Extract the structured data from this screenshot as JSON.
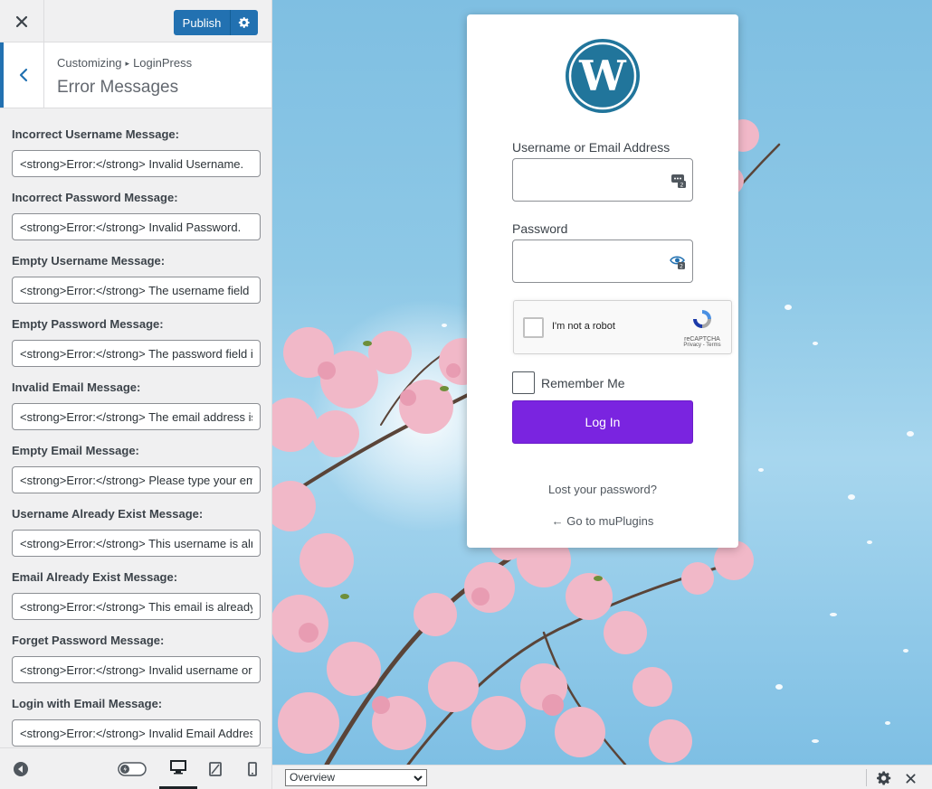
{
  "topbar": {
    "publish_label": "Publish"
  },
  "section": {
    "breadcrumb_parent": "Customizing",
    "breadcrumb_child": "LoginPress",
    "title": "Error Messages"
  },
  "controls": [
    {
      "label": "Incorrect Username Message:",
      "value": "<strong>Error:</strong> Invalid Username."
    },
    {
      "label": "Incorrect Password Message:",
      "value": "<strong>Error:</strong> Invalid Password."
    },
    {
      "label": "Empty Username Message:",
      "value": "<strong>Error:</strong> The username field is empty."
    },
    {
      "label": "Empty Password Message:",
      "value": "<strong>Error:</strong> The password field is empty."
    },
    {
      "label": "Invalid Email Message:",
      "value": "<strong>Error:</strong> The email address isn't correct.."
    },
    {
      "label": "Empty Email Message:",
      "value": "<strong>Error:</strong> Please type your email address."
    },
    {
      "label": "Username Already Exist Message:",
      "value": "<strong>Error:</strong> This username is already registered."
    },
    {
      "label": "Email Already Exist Message:",
      "value": "<strong>Error:</strong> This email is already registered."
    },
    {
      "label": "Forget Password Message:",
      "value": "<strong>Error:</strong> Invalid username or email."
    },
    {
      "label": "Login with Email Message:",
      "value": "<strong>Error:</strong> Invalid Email Address"
    }
  ],
  "login": {
    "username_label": "Username or Email Address",
    "password_label": "Password",
    "recaptcha_text": "I'm not a robot",
    "recaptcha_brand": "reCAPTCHA",
    "recaptcha_links": "Privacy - Terms",
    "remember_label": "Remember Me",
    "login_button": "Log In",
    "lost_password": "Lost your password?",
    "back_link": "← Go to muPlugins",
    "button_color": "#7a24e0"
  },
  "preview_bar": {
    "select_value": "Overview"
  },
  "colors": {
    "accent": "#2271b1",
    "wp_logo": "#21759b"
  }
}
